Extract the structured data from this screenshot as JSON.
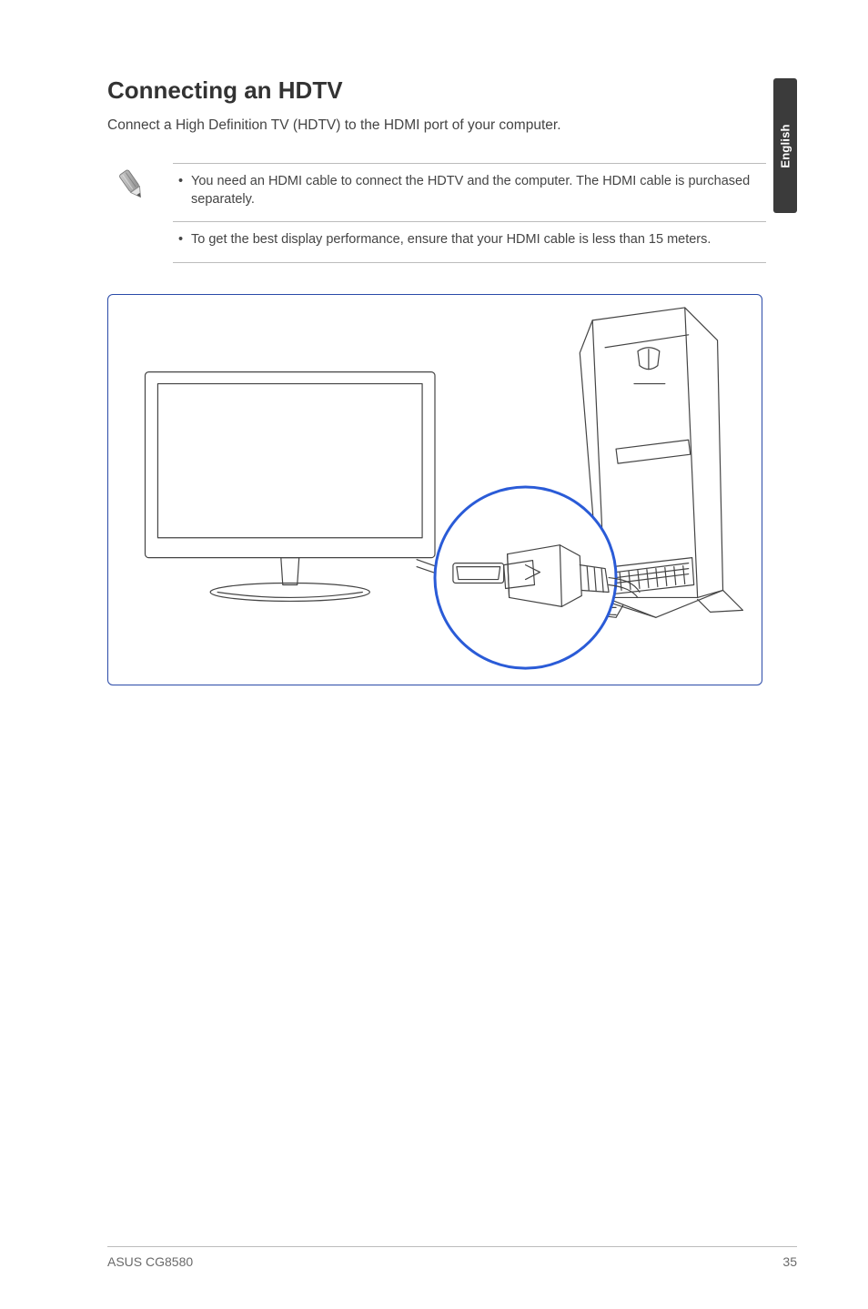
{
  "sideTab": {
    "label": "English"
  },
  "heading": "Connecting an HDTV",
  "intro": "Connect a High Definition TV (HDTV) to the HDMI port of your computer.",
  "notes": {
    "items": [
      "You need an HDMI cable to connect the HDTV and the computer. The HDMI cable is purchased separately.",
      "To get the best display performance, ensure that your HDMI cable is less than 15 meters."
    ]
  },
  "figure": {
    "alt": "Diagram of a monitor/HDTV and an ASUS ROG tower with a magnified HDMI connection"
  },
  "footer": {
    "left": "ASUS CG8580",
    "right": "35"
  }
}
